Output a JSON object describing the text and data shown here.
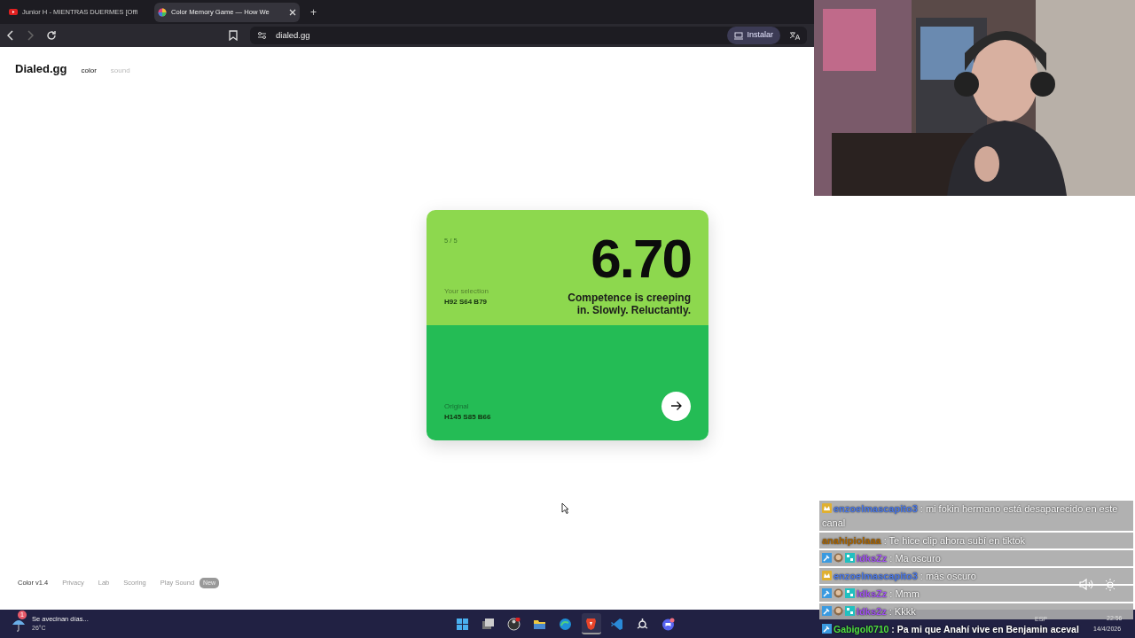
{
  "browser": {
    "tabs": [
      {
        "title": "Junior H - MIENTRAS DUERMES [Offi",
        "kind": "video",
        "selected": false
      },
      {
        "title": "Color Memory Game — How We",
        "kind": "color",
        "selected": true
      }
    ],
    "new_tab": "+",
    "address": "dialed.gg",
    "install_button": "Instalar"
  },
  "site": {
    "logo": "Dialed.gg",
    "nav": [
      {
        "label": "color",
        "selected": true
      },
      {
        "label": "sound",
        "selected": false
      }
    ]
  },
  "result": {
    "round": "5 / 5",
    "score": "6.70",
    "message": "Competence is creeping in. Slowly. Reluctantly.",
    "swatches": [
      {
        "label": "Your selection",
        "value": "H92 S64 B79",
        "color": "#8dd84e"
      },
      {
        "label": "Original",
        "value": "H145 S85 B66",
        "color": "#24bc55"
      }
    ]
  },
  "footer": {
    "links": [
      "Color v1.4",
      "Privacy",
      "Lab",
      "Scoring",
      "Play Sound"
    ],
    "badge": "New"
  },
  "chat": [
    {
      "kind": "crown",
      "user": "enzoelmascapito3",
      "color": "#4a78e8",
      "message": ": mi fokin hermano está desaparecido en este canal"
    },
    {
      "kind": "none",
      "user": "anahipiolaaa",
      "color": "#a86400",
      "message": ": Te hice clip ahora subí en tiktok"
    },
    {
      "kind": "trio",
      "user": "ldksZz",
      "color": "#a050f0",
      "message": ": Ma oscuro"
    },
    {
      "kind": "crown",
      "user": "enzoelmascapito3",
      "color": "#4a78e8",
      "message": ": más oscuro"
    },
    {
      "kind": "trio",
      "user": "ldksZz",
      "color": "#a050f0",
      "message": ": Mmm"
    },
    {
      "kind": "trio",
      "user": "ldks2z",
      "color": "#a050f0",
      "message": ": Kkkk"
    },
    {
      "kind": "single",
      "user": "Gabigol0710",
      "color": "#50e040",
      "message": ": Pa mi que Anahí vive en Benjamin aceval"
    }
  ],
  "taskbar": {
    "weather": {
      "badge": "1",
      "title": "Se avecinan días...",
      "temperature": "26°C"
    },
    "apps": [
      {
        "kind": "windows",
        "selected": false
      },
      {
        "kind": "taskview",
        "selected": false
      },
      {
        "kind": "obs",
        "selected": false
      },
      {
        "kind": "folder",
        "selected": false
      },
      {
        "kind": "edge",
        "selected": false
      },
      {
        "kind": "brave",
        "selected": true
      },
      {
        "kind": "vscode",
        "selected": false
      },
      {
        "kind": "steam",
        "selected": false
      },
      {
        "kind": "discord",
        "selected": false
      }
    ],
    "tray": {
      "language": "ESP",
      "time": "22:56",
      "date": "14/4/2026"
    }
  }
}
